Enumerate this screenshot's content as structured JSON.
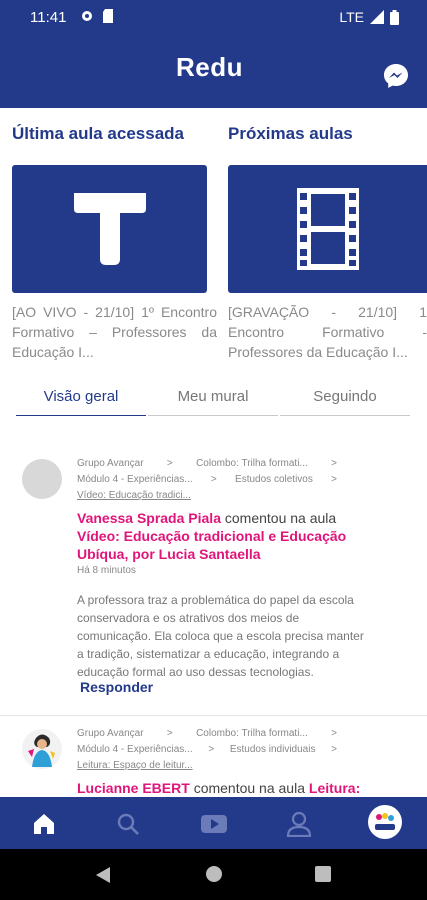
{
  "status_bar": {
    "time": "11:41",
    "network": "LTE"
  },
  "header": {
    "logo_text": "Redu"
  },
  "sections": {
    "last_class_title": "Última aula acessada",
    "next_classes_title": "Próximas aulas"
  },
  "cards": [
    {
      "icon": "text-icon",
      "caption": "[AO VIVO - 21/10] 1º Encontro Formativo – Professores da Educação I..."
    },
    {
      "icon": "film-icon",
      "caption": "[GRAVAÇÃO - 21/10] 1 Encontro Formativo - Professores da Educação I..."
    }
  ],
  "tabs": [
    "Visão geral",
    "Meu mural",
    "Seguindo"
  ],
  "posts": [
    {
      "crumbs": [
        [
          "Grupo Avançar",
          "Colombo: Trilha formati..."
        ],
        [
          "Módulo 4 - Experiências...",
          "Estudos coletivos"
        ],
        [
          "Vídeo: Educação tradici..."
        ]
      ],
      "author": "Vanessa Sprada Piala",
      "action": "comentou na aula",
      "lesson": "Vídeo: Educação tradicional e Educação Ubíqua, por Lucia Santaella",
      "time": "Há 8 minutos",
      "excerpt": "A professora traz a problemática do papel da escola conservadora e os atrativos dos meios de comunicação. Ela coloca que a escola precisa manter a tradição, sistematizar a educação, integrando a educação formal ao uso dessas tecnologias.",
      "reply_label": "Responder"
    },
    {
      "crumbs": [
        [
          "Grupo Avançar",
          "Colombo: Trilha formati..."
        ],
        [
          "Módulo 4 - Experiências...",
          "Estudos individuais"
        ],
        [
          "Leitura: Espaço de leitur..."
        ]
      ],
      "author": "Lucianne EBERT",
      "action": "comentou na aula",
      "lesson": "Leitura:"
    }
  ],
  "colors": {
    "brand": "#233a8b",
    "accent": "#e0157a"
  },
  "bottom_nav": [
    "home-icon",
    "search-icon",
    "video-icon",
    "profile-icon",
    "redu-avatar"
  ]
}
